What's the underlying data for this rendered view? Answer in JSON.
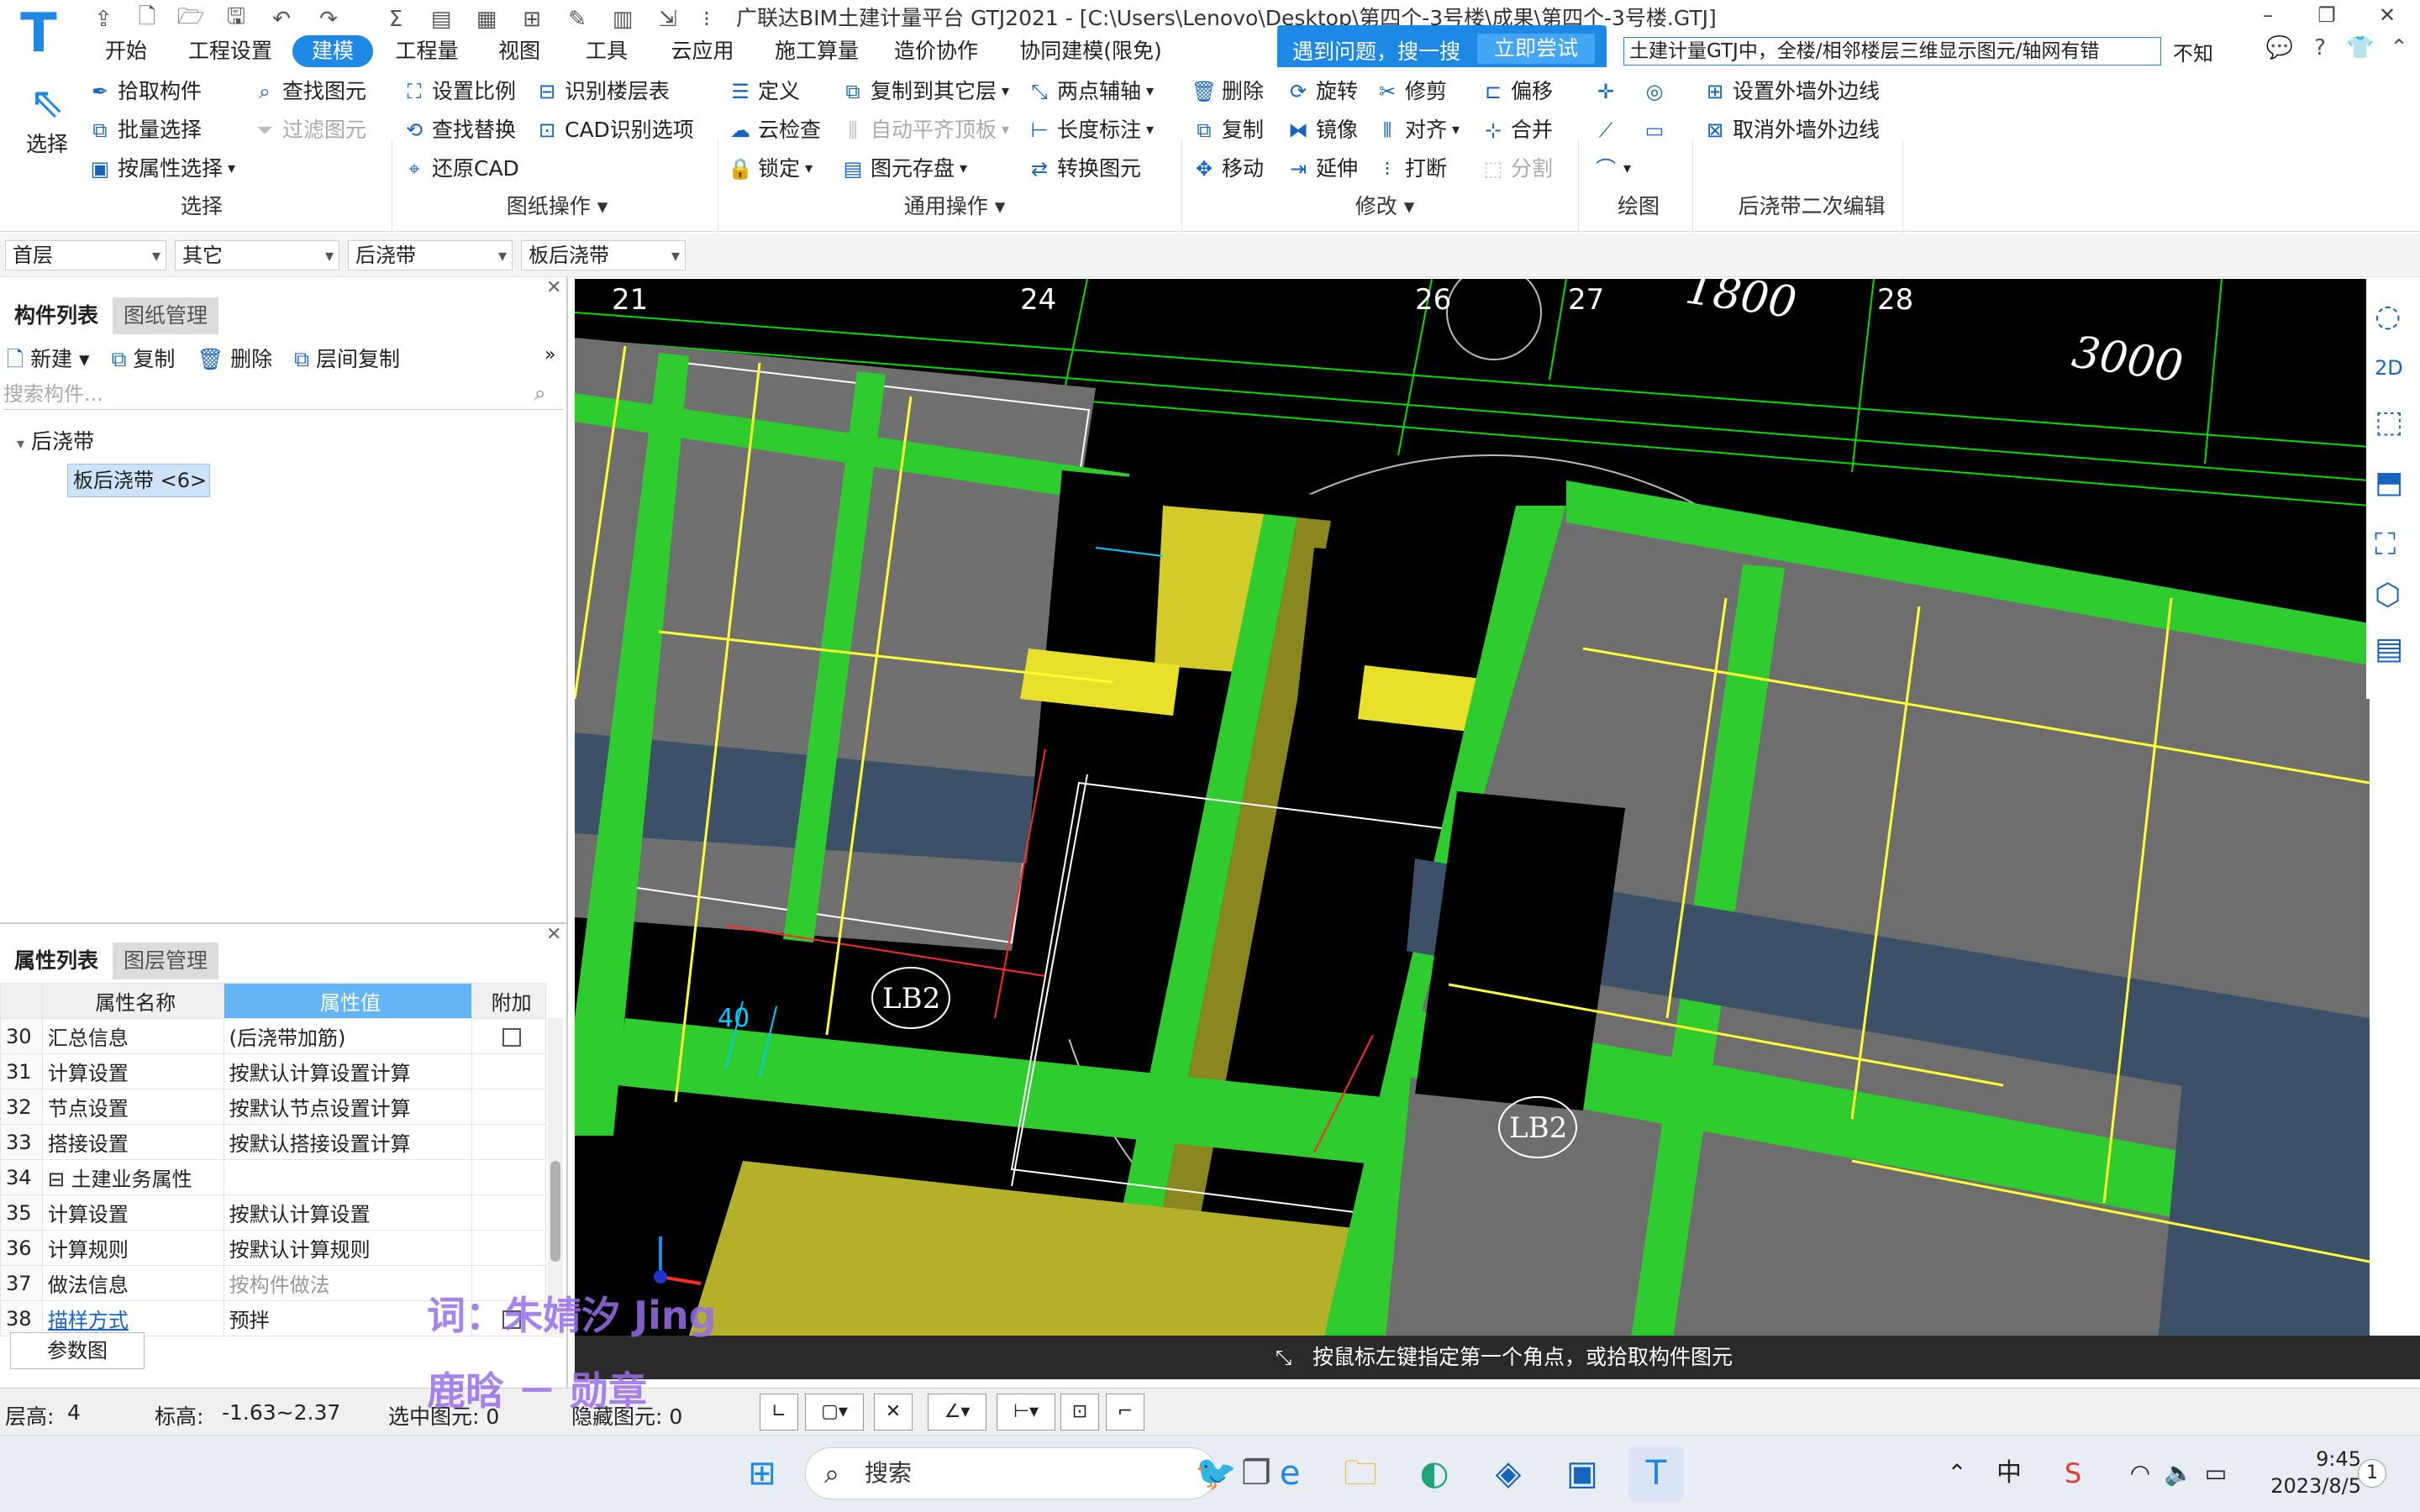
{
  "window": {
    "title": "广联达BIM土建计量平台 GTJ2021 - [C:\\Users\\Lenovo\\Desktop\\第四个-3号楼\\成果\\第四个-3号楼.GTJ]",
    "buttons": {
      "minimize": "–",
      "restore": "❐",
      "close": "✕"
    }
  },
  "menu": [
    "开始",
    "工程设置",
    "建模",
    "工程量",
    "视图",
    "工具",
    "云应用",
    "施工算量",
    "造价协作",
    "协同建模(限免)"
  ],
  "active_menu": "建模",
  "tip": {
    "text": "遇到问题，搜一搜",
    "button": "立即尝试"
  },
  "search_query": "土建计量GTJ中，全楼/相邻楼层三维显示图元/轴网有错",
  "search_extra": "不知",
  "ribbon": {
    "select": {
      "big": "选择",
      "items": [
        "拾取构件",
        "批量选择",
        "按属性选择",
        "查找图元",
        "过滤图元"
      ],
      "group": "选择"
    },
    "drawing": {
      "items": [
        "设置比例",
        "查找替换",
        "还原CAD",
        "识别楼层表",
        "CAD识别选项"
      ],
      "group": "图纸操作"
    },
    "general": {
      "items": [
        "定义",
        "云检查",
        "锁定",
        "复制到其它层",
        "自动平齐顶板",
        "图元存盘",
        "两点辅轴",
        "长度标注",
        "转换图元"
      ],
      "group": "通用操作"
    },
    "modify": {
      "items": [
        "删除",
        "复制",
        "移动",
        "旋转",
        "镜像",
        "延伸",
        "修剪",
        "对齐",
        "打断",
        "偏移",
        "合并",
        "分割"
      ],
      "group": "修改"
    },
    "draw": {
      "group": "绘图"
    },
    "post": {
      "items": [
        "设置外墙外边线",
        "取消外墙外边线"
      ],
      "group": "后浇带二次编辑"
    }
  },
  "filters": [
    "首层",
    "其它",
    "后浇带",
    "板后浇带"
  ],
  "component_panel": {
    "tabs": [
      "构件列表",
      "图纸管理"
    ],
    "tools": [
      "新建",
      "复制",
      "删除",
      "层间复制"
    ],
    "search_placeholder": "搜索构件...",
    "tree_root": "后浇带",
    "tree_leaf": "板后浇带 <6>"
  },
  "property_panel": {
    "tabs": [
      "属性列表",
      "图层管理"
    ],
    "headers": [
      "属性名称",
      "属性值",
      "附加"
    ],
    "rows": [
      {
        "num": "30",
        "name": "汇总信息",
        "value": "(后浇带加筋)",
        "check": true
      },
      {
        "num": "31",
        "name": "计算设置",
        "value": "按默认计算设置计算",
        "check": false
      },
      {
        "num": "32",
        "name": "节点设置",
        "value": "按默认节点设置计算",
        "check": false
      },
      {
        "num": "33",
        "name": "搭接设置",
        "value": "按默认搭接设置计算",
        "check": false
      },
      {
        "num": "34",
        "name": "⊟ 土建业务属性",
        "value": "",
        "check": false
      },
      {
        "num": "35",
        "name": "计算设置",
        "value": "按默认计算设置",
        "check": false
      },
      {
        "num": "36",
        "name": "计算规则",
        "value": "按默认计算规则",
        "check": false
      },
      {
        "num": "37",
        "name": "做法信息",
        "value": "按构件做法",
        "check": false
      },
      {
        "num": "38",
        "name": "描样方式",
        "value": "预拌",
        "check": true
      }
    ],
    "param_button": "参数图"
  },
  "viewport": {
    "axis_labels": [
      "21",
      "24",
      "26",
      "27",
      "28"
    ],
    "dims": [
      "1800",
      "3000"
    ],
    "labels": [
      "LB2",
      "LB2",
      "40"
    ]
  },
  "status_message": "按鼠标左键指定第一个角点，或拾取构件图元",
  "statusbar": {
    "floor_label": "层高:",
    "floor_value": "4",
    "elev_label": "标高:",
    "elev_value": "-1.63~2.37",
    "selected": "选中图元: 0",
    "hidden": "隐藏图元: 0"
  },
  "watermark": {
    "line1": "词：朱婧汐 Jing",
    "line2": "鹿晗 － 勋章"
  },
  "taskbar": {
    "search": "搜索",
    "ime": "中",
    "time": "9:45",
    "date": "2023/8/5",
    "badge": "1"
  },
  "colors": {
    "accent": "#1e88e5",
    "green": "#2ecc2e",
    "yellow": "#ffff33",
    "olive": "#b5b02a",
    "slab": "#6e6e6e",
    "band": "#3c5068"
  }
}
